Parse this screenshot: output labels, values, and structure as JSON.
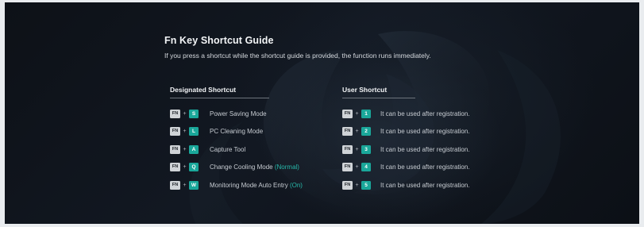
{
  "guide": {
    "title": "Fn Key Shortcut Guide",
    "subtitle": "If you press a shortcut while the shortcut guide is provided, the function runs immediately."
  },
  "designated": {
    "header": "Designated Shortcut",
    "rows": [
      {
        "fn": "FN",
        "plus": "+",
        "key": "S",
        "label": "Power Saving Mode",
        "state": ""
      },
      {
        "fn": "FN",
        "plus": "+",
        "key": "L",
        "label": "PC Cleaning Mode",
        "state": ""
      },
      {
        "fn": "FN",
        "plus": "+",
        "key": "A",
        "label": "Capture Tool",
        "state": ""
      },
      {
        "fn": "FN",
        "plus": "+",
        "key": "Q",
        "label": "Change Cooling Mode ",
        "state": "(Normal)"
      },
      {
        "fn": "FN",
        "plus": "+",
        "key": "W",
        "label": "Monitoring Mode Auto Entry ",
        "state": "(On)"
      }
    ]
  },
  "user": {
    "header": "User Shortcut",
    "rows": [
      {
        "fn": "FN",
        "plus": "+",
        "key": "1",
        "label": "It can be used after registration."
      },
      {
        "fn": "FN",
        "plus": "+",
        "key": "2",
        "label": "It can be used after registration."
      },
      {
        "fn": "FN",
        "plus": "+",
        "key": "3",
        "label": "It can be used after registration."
      },
      {
        "fn": "FN",
        "plus": "+",
        "key": "4",
        "label": "It can be used after registration."
      },
      {
        "fn": "FN",
        "plus": "+",
        "key": "5",
        "label": "It can be used after registration."
      }
    ]
  },
  "colors": {
    "accent": "#1aa79a",
    "state_text": "#27b8aa",
    "fn_key": "#cfd3d7",
    "background": "#0e1218",
    "frame": "#e9ecef"
  }
}
